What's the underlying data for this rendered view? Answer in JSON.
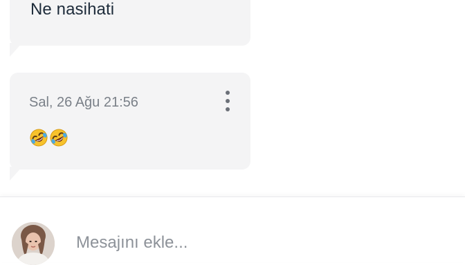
{
  "previous_message": {
    "text": "Ne nasihati"
  },
  "current_message": {
    "timestamp": "Sal, 26 Ağu 21:56",
    "emojis": [
      "rolling-on-floor-laughing-emoji",
      "rolling-on-floor-laughing-emoji"
    ],
    "menu_icon": "more-vertical-icon"
  },
  "composer": {
    "placeholder": "Mesajını ekle...",
    "value": ""
  },
  "colors": {
    "bubble_background": "#f4f4f5",
    "message_text": "#1d2b3a",
    "timestamp_text": "#7a8088",
    "placeholder_text": "#8d9299"
  }
}
